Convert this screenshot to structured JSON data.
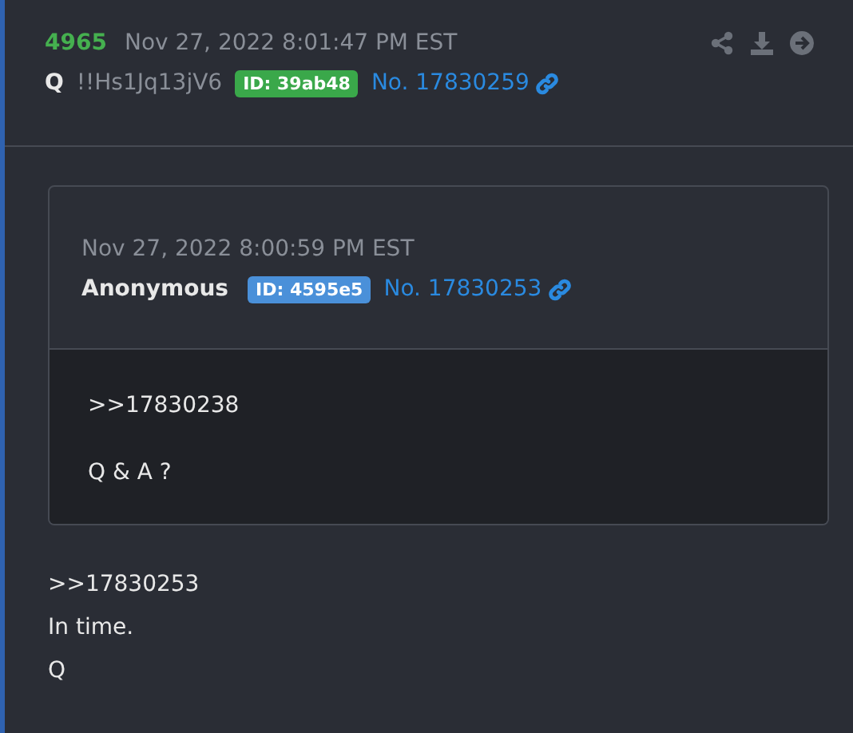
{
  "post": {
    "number": "4965",
    "timestamp": "Nov 27, 2022 8:01:47 PM EST",
    "author": "Q",
    "tripcode": "!!Hs1Jq13jV6",
    "id_badge": {
      "text": "ID: 39ab48",
      "color": "#3aa84a"
    },
    "post_no": "No. 17830259",
    "quote": {
      "timestamp": "Nov 27, 2022 8:00:59 PM EST",
      "author": "Anonymous",
      "id_badge": {
        "text": "ID: 4595e5",
        "color": "#4a90d9"
      },
      "post_no": "No. 17830253",
      "body": [
        ">>17830238",
        "Q & A ?"
      ]
    },
    "body": [
      ">>17830253",
      "In time.",
      "Q"
    ]
  }
}
